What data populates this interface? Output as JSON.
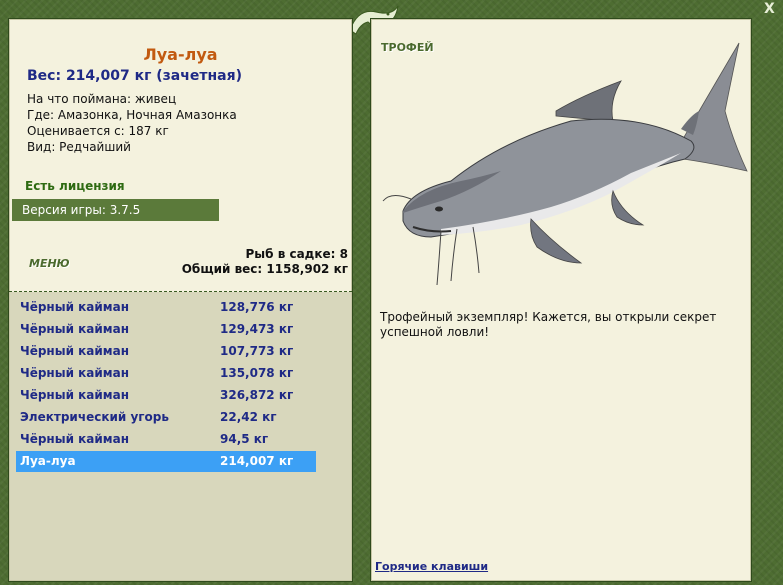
{
  "fish": {
    "name": "Луа-луа",
    "weight_line": "Вес: 214,007 кг (зачетная)",
    "bait": "На что поймана: живец",
    "location": "Где: Амазонка, Ночная Амазонка",
    "valued_from": "Оценивается с: 187 кг",
    "kind": "Вид: Редчайший"
  },
  "license": "Есть лицензия",
  "version": "Версия игры: 3.7.5",
  "menu_label": "МЕНЮ",
  "keep": {
    "count": "Рыб в садке: 8",
    "total": "Общий вес: 1158,902 кг"
  },
  "catch_list": [
    {
      "name": "Чёрный кайман",
      "weight": "128,776 кг"
    },
    {
      "name": "Чёрный кайман",
      "weight": "129,473 кг"
    },
    {
      "name": "Чёрный кайман",
      "weight": "107,773 кг"
    },
    {
      "name": "Чёрный кайман",
      "weight": "135,078 кг"
    },
    {
      "name": "Чёрный кайман",
      "weight": "326,872 кг"
    },
    {
      "name": "Электрический угорь",
      "weight": "22,42 кг"
    },
    {
      "name": "Чёрный кайман",
      "weight": "94,5 кг"
    },
    {
      "name": "Луа-луа",
      "weight": "214,007 кг"
    }
  ],
  "trophy": {
    "label": "ТРОФЕЙ",
    "text": "Трофейный экземпляр! Кажется, вы открыли секрет успешной ловли!"
  },
  "hotkeys": "Горячие клавиши",
  "close": "X",
  "colors": {
    "frame": "#4e6d32",
    "panel": "#f4f2de",
    "list_bg": "#d8d7bc",
    "selected": "#3ca0f5",
    "title": "#c25a10",
    "link": "#1f2a86"
  }
}
